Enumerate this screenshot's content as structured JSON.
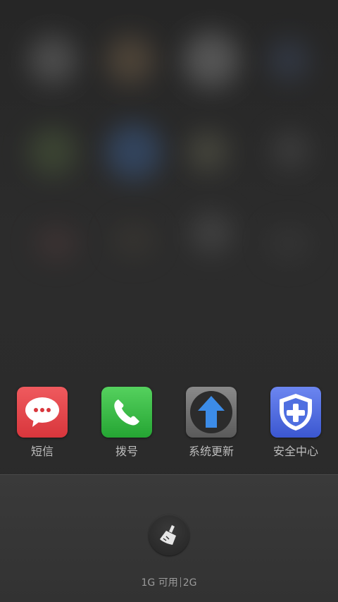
{
  "dock": {
    "apps": [
      {
        "label": "短信",
        "icon": "message-icon",
        "color": "#e84a4f"
      },
      {
        "label": "拨号",
        "icon": "phone-icon",
        "color": "#3dbb48"
      },
      {
        "label": "系统更新",
        "icon": "update-arrow-icon",
        "color": "#2f7fd8"
      },
      {
        "label": "安全中心",
        "icon": "shield-cross-icon",
        "color": "#4f6fe0"
      }
    ]
  },
  "recent_panel": {
    "clean_icon": "broom-icon",
    "memory_free": "1G 可用",
    "memory_total": "2G"
  }
}
